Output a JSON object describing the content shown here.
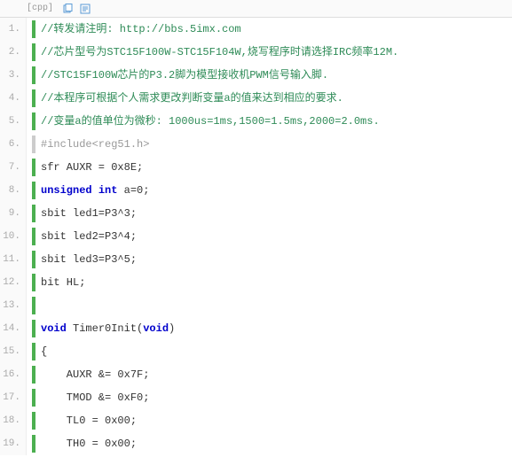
{
  "header": {
    "lang_tag": "[cpp]",
    "copy_icon": "copy",
    "view_icon": "view"
  },
  "lines": [
    {
      "n": "1.",
      "cls": "cm",
      "text": "//转发请注明: http://bbs.5imx.com"
    },
    {
      "n": "2.",
      "cls": "cm",
      "text": "//芯片型号为STC15F100W-STC15F104W,烧写程序时请选择IRC频率12M."
    },
    {
      "n": "3.",
      "cls": "cm",
      "text": "//STC15F100W芯片的P3.2脚为模型接收机PWM信号输入脚."
    },
    {
      "n": "4.",
      "cls": "cm",
      "text": "//本程序可根据个人需求更改判断变量a的值来达到相应的要求."
    },
    {
      "n": "5.",
      "cls": "cm",
      "text": "//变量a的值单位为微秒: 1000us=1ms,1500=1.5ms,2000=2.0ms."
    },
    {
      "n": "6.",
      "cls": "pp",
      "text": "#include<reg51.h>",
      "bar": "grey"
    },
    {
      "n": "7.",
      "cls": "",
      "tokens": [
        {
          "t": "sfr AUXR = 0x8E;",
          "c": ""
        }
      ]
    },
    {
      "n": "8.",
      "cls": "",
      "tokens": [
        {
          "t": "unsigned",
          "c": "kw"
        },
        {
          "t": " ",
          "c": ""
        },
        {
          "t": "int",
          "c": "kw"
        },
        {
          "t": " a=0;",
          "c": ""
        }
      ]
    },
    {
      "n": "9.",
      "cls": "",
      "tokens": [
        {
          "t": "sbit led1=P3^3;",
          "c": ""
        }
      ]
    },
    {
      "n": "10.",
      "cls": "",
      "tokens": [
        {
          "t": "sbit led2=P3^4;",
          "c": ""
        }
      ]
    },
    {
      "n": "11.",
      "cls": "",
      "tokens": [
        {
          "t": "sbit led3=P3^5;",
          "c": ""
        }
      ]
    },
    {
      "n": "12.",
      "cls": "",
      "tokens": [
        {
          "t": "bit HL;",
          "c": ""
        }
      ]
    },
    {
      "n": "13.",
      "cls": "",
      "text": ""
    },
    {
      "n": "14.",
      "cls": "",
      "tokens": [
        {
          "t": "void",
          "c": "kw"
        },
        {
          "t": " Timer0Init(",
          "c": ""
        },
        {
          "t": "void",
          "c": "kw"
        },
        {
          "t": ")",
          "c": ""
        }
      ]
    },
    {
      "n": "15.",
      "cls": "",
      "text": "{"
    },
    {
      "n": "16.",
      "cls": "",
      "text": "    AUXR &= 0x7F;"
    },
    {
      "n": "17.",
      "cls": "",
      "text": "    TMOD &= 0xF0;"
    },
    {
      "n": "18.",
      "cls": "",
      "text": "    TL0 = 0x00;"
    },
    {
      "n": "19.",
      "cls": "",
      "text": "    TH0 = 0x00;"
    }
  ]
}
